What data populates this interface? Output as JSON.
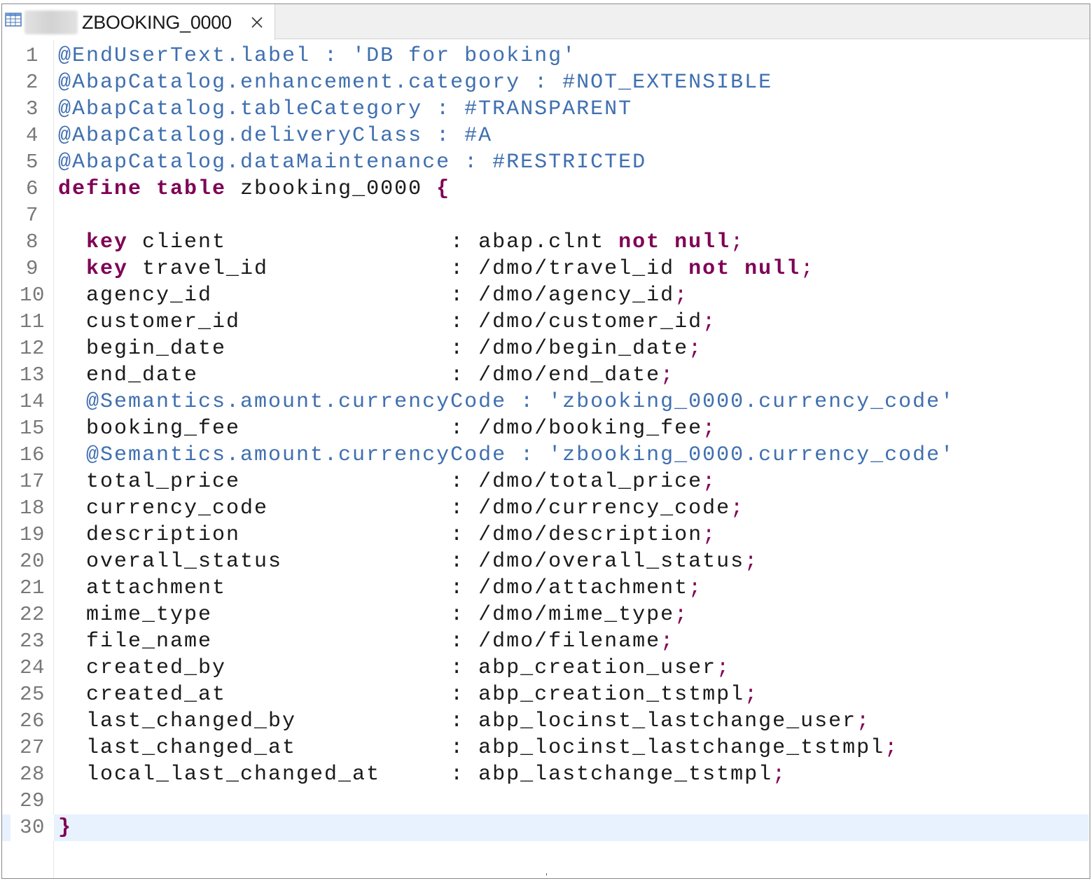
{
  "tab": {
    "title": "ZBOOKING_0000",
    "icon": "table-grid-icon",
    "close_icon": "close-icon"
  },
  "editor": {
    "current_line": 30,
    "lines": [
      {
        "n": "1",
        "segments": [
          {
            "t": "@EndUserText.label : 'DB for booking'",
            "c": "ann"
          }
        ]
      },
      {
        "n": "2",
        "segments": [
          {
            "t": "@AbapCatalog.enhancement.category : #NOT_EXTENSIBLE",
            "c": "ann"
          }
        ]
      },
      {
        "n": "3",
        "segments": [
          {
            "t": "@AbapCatalog.tableCategory : #TRANSPARENT",
            "c": "ann"
          }
        ]
      },
      {
        "n": "4",
        "segments": [
          {
            "t": "@AbapCatalog.deliveryClass : #A",
            "c": "ann"
          }
        ]
      },
      {
        "n": "5",
        "segments": [
          {
            "t": "@AbapCatalog.dataMaintenance : #RESTRICTED",
            "c": "ann"
          }
        ]
      },
      {
        "n": "6",
        "segments": [
          {
            "t": "define table",
            "c": "kw"
          },
          {
            "t": " zbooking_0000 ",
            "c": "txt"
          },
          {
            "t": "{",
            "c": "kw"
          }
        ]
      },
      {
        "n": "7",
        "segments": []
      },
      {
        "n": "8",
        "segments": [
          {
            "t": "  ",
            "c": "txt"
          },
          {
            "t": "key",
            "c": "kw"
          },
          {
            "t": " client                : abap.clnt ",
            "c": "txt"
          },
          {
            "t": "not null",
            "c": "kw"
          },
          {
            "t": ";",
            "c": "punct"
          }
        ]
      },
      {
        "n": "9",
        "segments": [
          {
            "t": "  ",
            "c": "txt"
          },
          {
            "t": "key",
            "c": "kw"
          },
          {
            "t": " travel_id             : /dmo/travel_id ",
            "c": "txt"
          },
          {
            "t": "not null",
            "c": "kw"
          },
          {
            "t": ";",
            "c": "punct"
          }
        ]
      },
      {
        "n": "10",
        "segments": [
          {
            "t": "  agency_id                 : /dmo/agency_id",
            "c": "txt"
          },
          {
            "t": ";",
            "c": "punct"
          }
        ]
      },
      {
        "n": "11",
        "segments": [
          {
            "t": "  customer_id               : /dmo/customer_id",
            "c": "txt"
          },
          {
            "t": ";",
            "c": "punct"
          }
        ]
      },
      {
        "n": "12",
        "segments": [
          {
            "t": "  begin_date                : /dmo/begin_date",
            "c": "txt"
          },
          {
            "t": ";",
            "c": "punct"
          }
        ]
      },
      {
        "n": "13",
        "segments": [
          {
            "t": "  end_date                  : /dmo/end_date",
            "c": "txt"
          },
          {
            "t": ";",
            "c": "punct"
          }
        ]
      },
      {
        "n": "14",
        "segments": [
          {
            "t": "  @Semantics.amount.currencyCode : 'zbooking_0000.currency_code'",
            "c": "ann"
          }
        ]
      },
      {
        "n": "15",
        "segments": [
          {
            "t": "  booking_fee               : /dmo/booking_fee",
            "c": "txt"
          },
          {
            "t": ";",
            "c": "punct"
          }
        ]
      },
      {
        "n": "16",
        "segments": [
          {
            "t": "  @Semantics.amount.currencyCode : 'zbooking_0000.currency_code'",
            "c": "ann"
          }
        ]
      },
      {
        "n": "17",
        "segments": [
          {
            "t": "  total_price               : /dmo/total_price",
            "c": "txt"
          },
          {
            "t": ";",
            "c": "punct"
          }
        ]
      },
      {
        "n": "18",
        "segments": [
          {
            "t": "  currency_code             : /dmo/currency_code",
            "c": "txt"
          },
          {
            "t": ";",
            "c": "punct"
          }
        ]
      },
      {
        "n": "19",
        "segments": [
          {
            "t": "  description               : /dmo/description",
            "c": "txt"
          },
          {
            "t": ";",
            "c": "punct"
          }
        ]
      },
      {
        "n": "20",
        "segments": [
          {
            "t": "  overall_status            : /dmo/overall_status",
            "c": "txt"
          },
          {
            "t": ";",
            "c": "punct"
          }
        ]
      },
      {
        "n": "21",
        "segments": [
          {
            "t": "  attachment                : /dmo/attachment",
            "c": "txt"
          },
          {
            "t": ";",
            "c": "punct"
          }
        ]
      },
      {
        "n": "22",
        "segments": [
          {
            "t": "  mime_type                 : /dmo/mime_type",
            "c": "txt"
          },
          {
            "t": ";",
            "c": "punct"
          }
        ]
      },
      {
        "n": "23",
        "segments": [
          {
            "t": "  file_name                 : /dmo/filename",
            "c": "txt"
          },
          {
            "t": ";",
            "c": "punct"
          }
        ]
      },
      {
        "n": "24",
        "segments": [
          {
            "t": "  created_by                : abp_creation_user",
            "c": "txt"
          },
          {
            "t": ";",
            "c": "punct"
          }
        ]
      },
      {
        "n": "25",
        "segments": [
          {
            "t": "  created_at                : abp_creation_tstmpl",
            "c": "txt"
          },
          {
            "t": ";",
            "c": "punct"
          }
        ]
      },
      {
        "n": "26",
        "segments": [
          {
            "t": "  last_changed_by           : abp_locinst_lastchange_user",
            "c": "txt"
          },
          {
            "t": ";",
            "c": "punct"
          }
        ]
      },
      {
        "n": "27",
        "segments": [
          {
            "t": "  last_changed_at           : abp_locinst_lastchange_tstmpl",
            "c": "txt"
          },
          {
            "t": ";",
            "c": "punct"
          }
        ]
      },
      {
        "n": "28",
        "segments": [
          {
            "t": "  local_last_changed_at     : abp_lastchange_tstmpl",
            "c": "txt"
          },
          {
            "t": ";",
            "c": "punct"
          }
        ]
      },
      {
        "n": "29",
        "segments": []
      },
      {
        "n": "30",
        "segments": [
          {
            "t": "}",
            "c": "kw"
          }
        ]
      }
    ]
  },
  "colors": {
    "annotation": "#3f6fb0",
    "keyword": "#7f0055",
    "text": "#1a1a1a",
    "line_number": "#787878",
    "current_line_bg": "#e8f2fe"
  }
}
